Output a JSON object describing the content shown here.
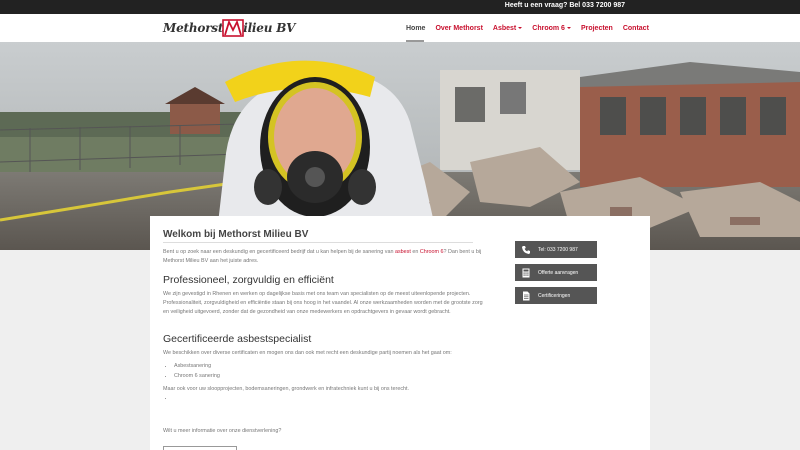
{
  "topbar": {
    "text": "Heeft u een vraag? Bel 033 7200 987"
  },
  "logo": {
    "part1": "Methorst",
    "part2": "ilieu BV"
  },
  "nav": {
    "items": [
      {
        "label": "Home",
        "active": true,
        "dropdown": false
      },
      {
        "label": "Over Methorst",
        "active": false,
        "dropdown": false
      },
      {
        "label": "Asbest",
        "active": false,
        "dropdown": true
      },
      {
        "label": "Chroom 6",
        "active": false,
        "dropdown": true
      },
      {
        "label": "Projecten",
        "active": false,
        "dropdown": false
      },
      {
        "label": "Contact",
        "active": false,
        "dropdown": false
      }
    ]
  },
  "main": {
    "title": "Welkom bij Methorst Milieu BV",
    "intro_a": "Bent u op zoek naar een deskundig en gecertificeerd bedrijf dat u kan helpen bij de sanering van ",
    "intro_link1": "asbest",
    "intro_b": " en ",
    "intro_link2": "Chroom 6",
    "intro_c": "? Dan bent u bij Methorst Milieu BV aan het juiste adres.",
    "section1_title": "Professioneel, zorgvuldig en efficiënt",
    "section1_text": "We zijn gevestigd in Rhenen en werken op dagelijkse basis met ons team van specialisten op de meest uiteenlopende projecten. Professionaliteit, zorgvuldigheid en efficiëntie staan bij ons hoog in het vaandel. Al onze werkzaamheden worden met de grootste zorg en veiligheid uitgevoerd, zonder dat de gezondheid van onze medewerkers en opdrachtgevers in gevaar wordt gebracht.",
    "section2_title": "Gecertificeerde asbestspecialist",
    "section2_text": "We beschikken over diverse certificaten en mogen ons dan ook met recht een deskundige partij noemen als het gaat om:",
    "list": [
      "Asbestsanering",
      "Chroom 6 sanering"
    ],
    "extra_text": "Maar ook voor uw sloopprojecten, bodemsaneringen, grondwerk en infratechniek kunt u bij ons terecht.",
    "cta_question": "Wilt u meer informatie over onze dienstverlening?"
  },
  "sidebar": {
    "buttons": [
      {
        "label": "Tel: 033 7200 987",
        "icon": "phone-icon"
      },
      {
        "label": "Offerte aanvragen",
        "icon": "calculator-icon"
      },
      {
        "label": "Certificeringen",
        "icon": "document-icon"
      }
    ]
  },
  "colors": {
    "accent": "#c8102e",
    "topbar": "#222222",
    "sidebar_button": "#555555"
  }
}
